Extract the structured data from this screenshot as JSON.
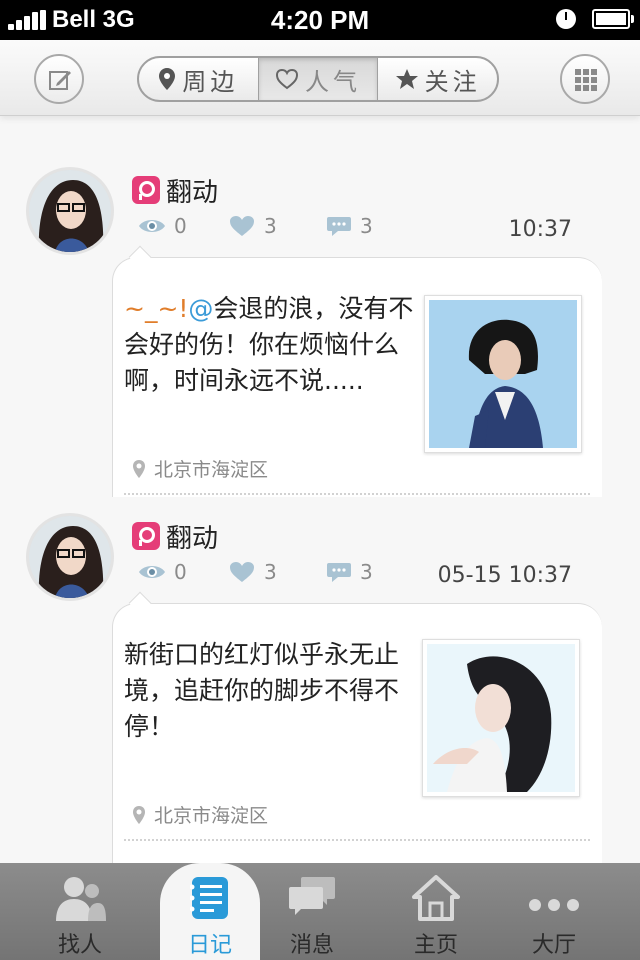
{
  "status_bar": {
    "carrier": "Bell 3G",
    "time": "4:20 PM"
  },
  "nav": {
    "compose_icon": "compose-icon",
    "grid_icon": "grid-icon",
    "segments": [
      {
        "label": "周边",
        "icon": "location-pin-icon",
        "active": false
      },
      {
        "label": "人气",
        "icon": "heart-icon",
        "active": true
      },
      {
        "label": "关注",
        "icon": "star-icon",
        "active": false
      }
    ]
  },
  "posts": [
    {
      "username": "翻动",
      "views": "0",
      "likes": "3",
      "comments": "3",
      "time": "10:37",
      "text_prefix": "~_~!",
      "text_mention": "@",
      "text_body": "会退的浪，没有不会好的伤！你在烦恼什么啊，时间永远不说.....",
      "location": "北京市海淀区"
    },
    {
      "username": "翻动",
      "views": "0",
      "likes": "3",
      "comments": "3",
      "time": "05-15 10:37",
      "text_prefix": "",
      "text_mention": "",
      "text_body": "新街口的红灯似乎永无止境，追赶你的脚步不得不停！",
      "location": "北京市海淀区"
    }
  ],
  "tabs": [
    {
      "label": "找人",
      "icon": "people-icon",
      "active": false
    },
    {
      "label": "日记",
      "icon": "notebook-icon",
      "active": true
    },
    {
      "label": "消息",
      "icon": "chat-bubbles-icon",
      "active": false
    },
    {
      "label": "主页",
      "icon": "home-icon",
      "active": false
    },
    {
      "label": "大厅",
      "icon": "more-dots-icon",
      "active": false
    }
  ],
  "colors": {
    "accent_blue": "#2a9ad8",
    "brand_pink": "#e53d78",
    "mention_orange": "#e07d2a"
  }
}
